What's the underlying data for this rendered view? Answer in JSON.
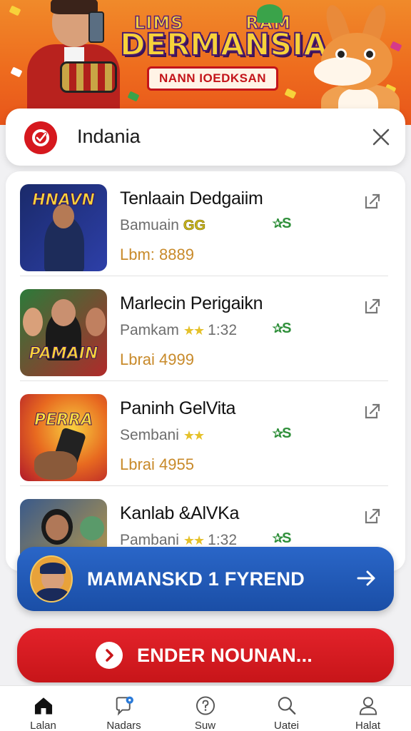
{
  "banner": {
    "logo_line1_left": "LIMS",
    "logo_line1_right": "RAM",
    "logo_title": "DERMANSIA",
    "logo_ribbon": "NANN IOEDKSAN"
  },
  "search": {
    "value": "Indania"
  },
  "items": [
    {
      "title": "Tenlaain Dedgaiim",
      "sub": "Bamuain",
      "badge": "GG",
      "stars": "",
      "time": "",
      "rating": "S",
      "price": "Lbm: 8889",
      "thumb_text": "HNAVN",
      "thumb_colors": [
        "#1a2a6a",
        "#2d3fa8"
      ]
    },
    {
      "title": "Marlecin Perigaikn",
      "sub": "Pamkam",
      "badge": "",
      "stars": "★★",
      "time": "1:32",
      "rating": "S",
      "price": "Lbrai 4999",
      "thumb_text": "PAMAIN",
      "thumb_colors": [
        "#2c7a3a",
        "#b02a2a"
      ]
    },
    {
      "title": "Paninh GelVita",
      "sub": "Sembani",
      "badge": "",
      "stars": "★★",
      "time": "",
      "rating": "S",
      "price": "Lbrai 4955",
      "thumb_text": "PERRA",
      "thumb_colors": [
        "#c8202a",
        "#f0a030"
      ]
    },
    {
      "title": "Kanlab &AlVKa",
      "sub": "Pambani",
      "badge": "",
      "stars": "★★",
      "time": "1:32",
      "rating": "S",
      "price": "",
      "thumb_text": "",
      "thumb_colors": [
        "#3a5a8a",
        "#c8a040"
      ]
    }
  ],
  "promo": {
    "label": "MAMANSKD 1 FYREND"
  },
  "cta": {
    "label": "ENDER NOUNAN..."
  },
  "nav": [
    {
      "label": "Lalan",
      "icon": "home-icon"
    },
    {
      "label": "Nadars",
      "icon": "chat-location-icon"
    },
    {
      "label": "Suw",
      "icon": "help-circle-icon"
    },
    {
      "label": "Uatei",
      "icon": "search-icon"
    },
    {
      "label": "Halat",
      "icon": "profile-icon"
    }
  ],
  "colors": {
    "accent_red": "#d6181e",
    "promo_blue": "#1a4ea6",
    "rating_green": "#2f8f3a",
    "price_gold": "#c88a2a"
  }
}
